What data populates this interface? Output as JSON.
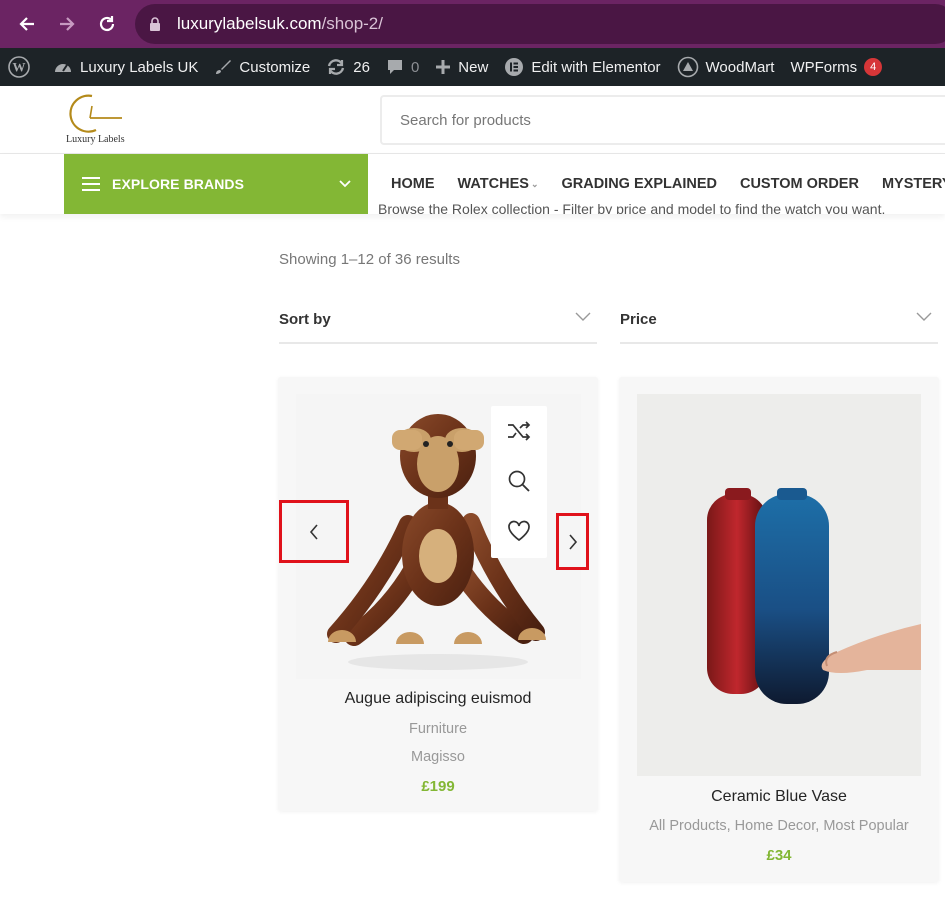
{
  "browser": {
    "url_domain": "luxurylabelsuk.com",
    "url_path": "/shop-2/"
  },
  "admin_bar": {
    "site_name": "Luxury Labels UK",
    "customize": "Customize",
    "updates_count": "26",
    "comments_count": "0",
    "new": "New",
    "elementor": "Edit with Elementor",
    "woodmart": "WoodMart",
    "wpforms": "WPForms",
    "wpforms_badge": "4"
  },
  "header": {
    "logo_text": "Luxury Labels",
    "search_placeholder": "Search for products"
  },
  "nav": {
    "explore_label": "EXPLORE BRANDS",
    "menu": [
      "HOME",
      "WATCHES",
      "GRADING EXPLAINED",
      "CUSTOM ORDER",
      "MYSTERY"
    ],
    "subtext": "Browse the Rolex collection - Filter by price and model to find the watch you want."
  },
  "shop": {
    "results_text": "Showing 1–12 of 36 results",
    "sort_label": "Sort by",
    "price_label": "Price"
  },
  "products": [
    {
      "title": "Augue adipiscing euismod",
      "category": "Furniture",
      "brand": "Magisso",
      "price": "£199"
    },
    {
      "title": "Ceramic Blue Vase",
      "categories": [
        "All Products",
        "Home Decor",
        "Most Popular"
      ],
      "price": "£34"
    }
  ],
  "colors": {
    "browser_bg": "#6b2463",
    "admin_bg": "#1d2327",
    "accent_green": "#83b735",
    "highlight_red": "#e0121b"
  }
}
